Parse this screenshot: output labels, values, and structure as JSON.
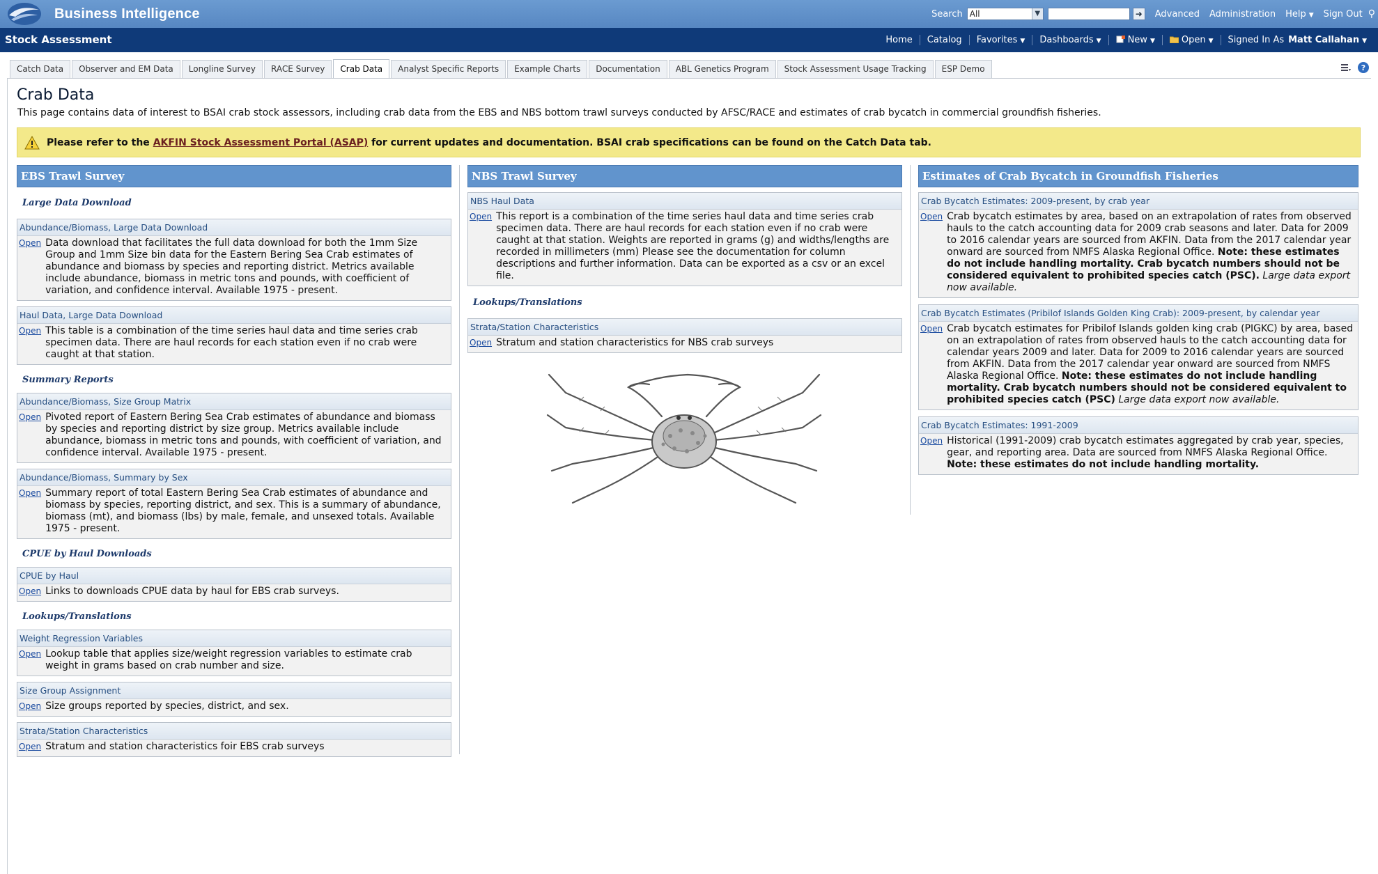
{
  "topbar": {
    "app_title": "Business Intelligence",
    "search_label": "Search",
    "search_scope": "All",
    "search_value": "",
    "links": [
      "Advanced",
      "Administration",
      "Help",
      "Sign Out"
    ]
  },
  "bar2": {
    "title": "Stock Assessment",
    "nav": [
      "Home",
      "Catalog",
      "Favorites",
      "Dashboards",
      "New",
      "Open"
    ],
    "signed_in_label": "Signed In As",
    "user": "Matt Callahan"
  },
  "tabs": [
    "Catch Data",
    "Observer and EM Data",
    "Longline Survey",
    "RACE Survey",
    "Crab Data",
    "Analyst Specific Reports",
    "Example Charts",
    "Documentation",
    "ABL Genetics Program",
    "Stock Assessment Usage Tracking",
    "ESP Demo"
  ],
  "active_tab": "Crab Data",
  "page": {
    "title": "Crab Data",
    "description": "This page contains data of interest to BSAI crab stock assessors, including crab data from the EBS and NBS bottom trawl surveys conducted by AFSC/RACE and estimates of crab bycatch in commercial groundfish fisheries.",
    "notice_before": "Please refer to the ",
    "notice_link": "AKFIN Stock Assessment Portal (ASAP)",
    "notice_after": " for current updates and documentation. BSAI crab specifications can be found on the Catch Data tab."
  },
  "open_label": "Open",
  "ebs": {
    "header": "EBS Trawl Survey",
    "large_data_heading": "Large Data Download",
    "card1_title": "Abundance/Biomass, Large Data Download",
    "card1_text": "Data download that facilitates the full data download for both the 1mm Size Group and 1mm Size bin data for the Eastern Bering Sea Crab estimates of abundance and biomass by species and reporting district. Metrics available include abundance, biomass in metric tons and pounds, with coefficient of variation, and confidence interval. Available 1975 - present.",
    "card2_title": "Haul Data, Large Data Download",
    "card2_text": "This table is a combination of the time series haul data and time series crab specimen data. There are haul records for each station even if no crab were caught at that station.",
    "summary_heading": "Summary Reports",
    "card3_title": "Abundance/Biomass, Size Group Matrix",
    "card3_text": "Pivoted report of Eastern Bering Sea Crab estimates of abundance and biomass by species and reporting district by size group. Metrics available include abundance, biomass in metric tons and pounds, with coefficient of variation, and confidence interval. Available 1975 - present.",
    "card4_title": "Abundance/Biomass, Summary by Sex",
    "card4_text": "Summary report of total Eastern Bering Sea Crab estimates of abundance and biomass by species, reporting district, and sex. This is a summary of abundance, biomass (mt), and biomass (lbs) by male, female, and unsexed totals. Available 1975 - present.",
    "cpue_heading": "CPUE by Haul Downloads",
    "card5_title": "CPUE by Haul",
    "card5_text": "Links to downloads CPUE data by haul for EBS crab surveys.",
    "lookups_heading": "Lookups/Translations",
    "card6_title": "Weight Regression Variables",
    "card6_text": "Lookup table that applies size/weight regression variables to estimate crab weight in grams based on crab number and size.",
    "card7_title": "Size Group Assignment",
    "card7_text": "Size groups reported by species, district, and sex.",
    "card8_title": "Strata/Station Characteristics",
    "card8_text": "Stratum and station characteristics foir EBS crab surveys"
  },
  "nbs": {
    "header": "NBS Trawl Survey",
    "card1_title": "NBS Haul Data",
    "card1_text": "This report is a combination of the time series haul data and time series crab specimen data. There are haul records for each station even if no crab were caught at that station. Weights are reported in grams (g) and widths/lengths are recorded in millimeters (mm) Please see the documentation for column descriptions and further information. Data can be exported as a csv or an excel file.",
    "lookups_heading": "Lookups/Translations",
    "card2_title": "Strata/Station Characteristics",
    "card2_text": "Stratum and station characteristics for NBS crab surveys"
  },
  "bycatch": {
    "header": "Estimates of Crab Bycatch in Groundfish Fisheries",
    "card1_title": "Crab Bycatch Estimates: 2009-present, by crab year",
    "card1_text": "Crab bycatch estimates by area, based on an extrapolation of rates from observed hauls to the catch accounting data for 2009 crab seasons and later. Data for 2009 to 2016 calendar years are sourced from AKFIN. Data from the 2017 calendar year onward are sourced from NMFS Alaska Regional Office. ",
    "card1_bold": "Note: these estimates do not include handling mortality. Crab bycatch numbers should not be considered equivalent to prohibited species catch (PSC).",
    "card1_italic": " Large data export now available.",
    "card2_title": "Crab Bycatch Estimates (Pribilof Islands Golden King Crab): 2009-present, by calendar year",
    "card2_text": "Crab bycatch estimates for Pribilof Islands golden king crab (PIGKC) by area, based on an extrapolation of rates from observed hauls to the catch accounting data for calendar years 2009 and later. Data for 2009 to 2016 calendar years are sourced from AKFIN. Data from the 2017 calendar year onward are sourced from NMFS Alaska Regional Office. ",
    "card2_bold": "Note: these estimates do not include handling mortality. Crab bycatch numbers should not be considered equivalent to prohibited species catch (PSC)",
    "card2_italic": " Large data export now available.",
    "card3_title": "Crab Bycatch Estimates: 1991-2009",
    "card3_text": "Historical (1991-2009) crab bycatch estimates aggregated by crab year, species, gear, and reporting area. Data are sourced from NMFS Alaska Regional Office. ",
    "card3_bold": "Note: these estimates do not include handling mortality."
  },
  "colors": {
    "topbar": "#5f90cb",
    "navbar": "#0f3a79",
    "section_header": "#6194cd",
    "notice": "#f3e98a"
  }
}
